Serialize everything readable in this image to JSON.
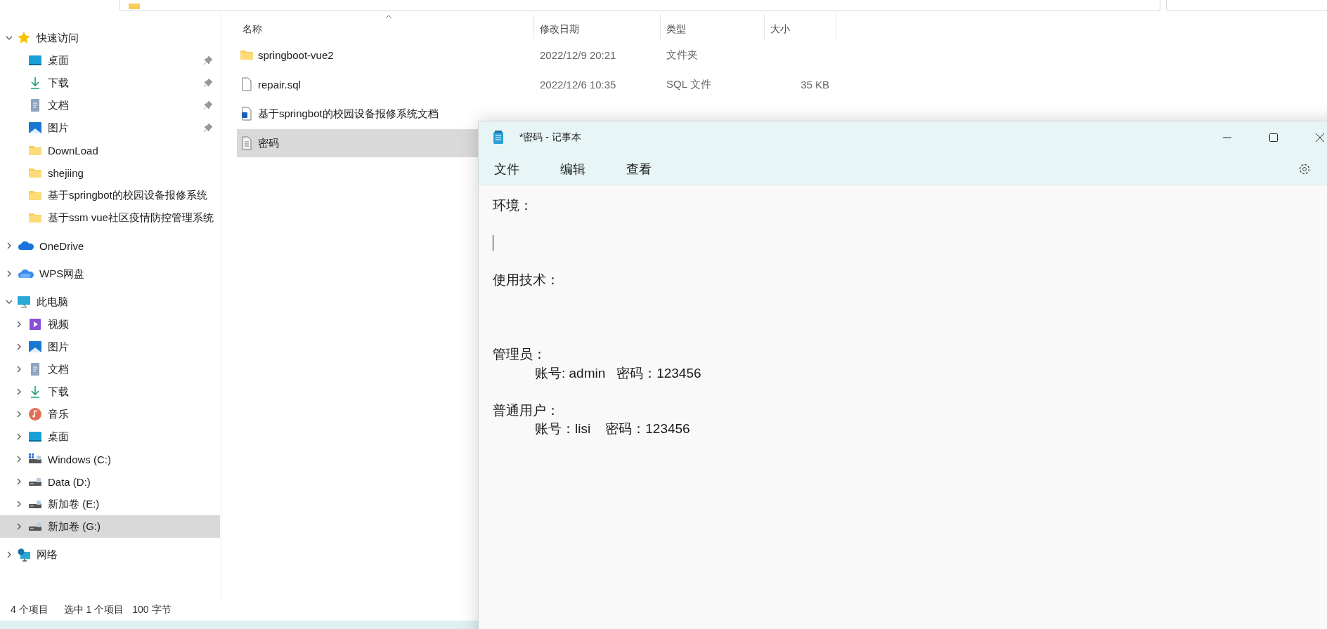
{
  "explorer": {
    "sidebar": {
      "items": [
        {
          "label": "快速访问",
          "kind": "star",
          "expanded": true,
          "selected": false,
          "children": [
            {
              "label": "桌面",
              "kind": "desktop",
              "pinned": true,
              "selected": false
            },
            {
              "label": "下载",
              "kind": "download",
              "pinned": true,
              "selected": false
            },
            {
              "label": "文档",
              "kind": "document",
              "pinned": true,
              "selected": false
            },
            {
              "label": "图片",
              "kind": "pictures",
              "pinned": true,
              "selected": false
            },
            {
              "label": "DownLoad",
              "kind": "folder",
              "pinned": false,
              "selected": false
            },
            {
              "label": "shejiing",
              "kind": "folder",
              "pinned": false,
              "selected": false
            },
            {
              "label": "基于springbot的校园设备报修系统",
              "kind": "folder",
              "pinned": false,
              "selected": false
            },
            {
              "label": "基于ssm vue社区疫情防控管理系统",
              "kind": "folder",
              "pinned": false,
              "selected": false
            }
          ]
        },
        {
          "label": "OneDrive",
          "kind": "cloud",
          "expanded": false,
          "selected": false
        },
        {
          "label": "WPS网盘",
          "kind": "wps-cloud",
          "expanded": false,
          "selected": false
        },
        {
          "label": "此电脑",
          "kind": "pc",
          "expanded": true,
          "selected": false,
          "children": [
            {
              "label": "视频",
              "kind": "video",
              "expanded": false,
              "selected": false
            },
            {
              "label": "图片",
              "kind": "pictures",
              "expanded": false,
              "selected": false
            },
            {
              "label": "文档",
              "kind": "document",
              "expanded": false,
              "selected": false
            },
            {
              "label": "下载",
              "kind": "download",
              "expanded": false,
              "selected": false
            },
            {
              "label": "音乐",
              "kind": "music",
              "expanded": false,
              "selected": false
            },
            {
              "label": "桌面",
              "kind": "desktop",
              "expanded": false,
              "selected": false
            },
            {
              "label": "Windows (C:)",
              "kind": "drive-windows",
              "expanded": false,
              "selected": false
            },
            {
              "label": "Data (D:)",
              "kind": "drive",
              "expanded": false,
              "selected": false
            },
            {
              "label": "新加卷 (E:)",
              "kind": "drive",
              "expanded": false,
              "selected": false
            },
            {
              "label": "新加卷 (G:)",
              "kind": "drive",
              "expanded": false,
              "selected": true
            }
          ]
        },
        {
          "label": "网络",
          "kind": "network",
          "expanded": false,
          "selected": false
        }
      ]
    },
    "columns": [
      {
        "label": "名称",
        "sorted": true
      },
      {
        "label": "修改日期",
        "sorted": false
      },
      {
        "label": "类型",
        "sorted": false
      },
      {
        "label": "大小",
        "sorted": false
      }
    ],
    "rows": [
      {
        "name": "springboot-vue2",
        "kind": "folder",
        "modified": "2022/12/9 20:21",
        "type": "文件夹",
        "selected": false
      },
      {
        "name": "repair.sql",
        "kind": "file",
        "modified": "2022/12/6 10:35",
        "type": "SQL 文件",
        "size": "35 KB",
        "selected": false
      },
      {
        "name": "基于springbot的校园设备报修系统文档",
        "kind": "word",
        "selected": false
      },
      {
        "name": "密码",
        "kind": "text",
        "selected": true
      }
    ],
    "status_bar": {
      "item_count": "4 个项目",
      "selection": "选中 1 个项目",
      "selection_size": "100 字节"
    }
  },
  "notepad": {
    "title": "*密码 - 记事本",
    "menu": [
      {
        "label": "文件"
      },
      {
        "label": "编辑"
      },
      {
        "label": "查看"
      }
    ],
    "lines": [
      {
        "kind": "text",
        "text": "环境："
      },
      {
        "kind": "blank"
      },
      {
        "kind": "cursor"
      },
      {
        "kind": "blank"
      },
      {
        "kind": "text",
        "text": "使用技术："
      },
      {
        "kind": "blank"
      },
      {
        "kind": "blank"
      },
      {
        "kind": "blank"
      },
      {
        "kind": "text",
        "text": "管理员："
      },
      {
        "kind": "indented",
        "text": "账号: admin   密码：123456"
      },
      {
        "kind": "blank"
      },
      {
        "kind": "text",
        "text": "普通用户："
      },
      {
        "kind": "indented",
        "text": "账号：lisi    密码：123456"
      }
    ]
  }
}
